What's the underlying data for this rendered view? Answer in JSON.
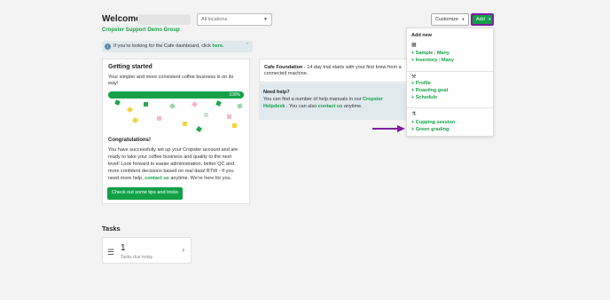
{
  "header": {
    "welcome": "Welcome",
    "group_link": "Cropster Support Demo Group",
    "locations_placeholder": "All locations",
    "customize_label": "Customize",
    "add_label": "Add"
  },
  "notice": {
    "text": "If you're looking for the Cafe dashboard, click",
    "link": "here",
    "suffix": "."
  },
  "getting_started": {
    "title": "Getting started",
    "subtitle": "Your simpler and more consistent coffee business is on its way!",
    "progress": "100%",
    "congrats_title": "Congratulations!",
    "body_1": "You have successfully set up your Cropster account and are ready to take your coffee business and quality to the next level! Look forward to easier administration, better QC and more confident decisions based on real data! BTW - If you need more help,",
    "body_link": "contact us",
    "body_2": "anytime. We're here for you.",
    "tips_button": "Check out some tips and tricks"
  },
  "tasks": {
    "heading": "Tasks",
    "count": "1",
    "due_label": "Tasks due today"
  },
  "foundation": {
    "name": "Cafe Foundation",
    "text": "- 14 day trial starts with your first brew from a connected machine."
  },
  "help": {
    "title": "Need help?",
    "text_1": "You can find a number of help manuals in our",
    "link_1": "Cropster Helpdesk",
    "text_2": ". You can also",
    "link_2": "contact us",
    "text_3": "anytime."
  },
  "add_menu": {
    "header": "Add new",
    "sections": [
      {
        "icon": "grid-icon",
        "items": [
          "+ Sample",
          "Many",
          "+ Inventory",
          "Many"
        ]
      },
      {
        "icon": "roast-icon",
        "items": [
          "+ Profile",
          "+ Roasting goal",
          "+ Schedule"
        ]
      },
      {
        "icon": "cupping-icon",
        "items": [
          "+ Cupping session",
          "+ Green grading"
        ]
      }
    ]
  },
  "colors": {
    "accent": "#13a047",
    "link": "#14a244",
    "highlight_border": "#7f1fa0",
    "background": "#f2f3f2"
  }
}
